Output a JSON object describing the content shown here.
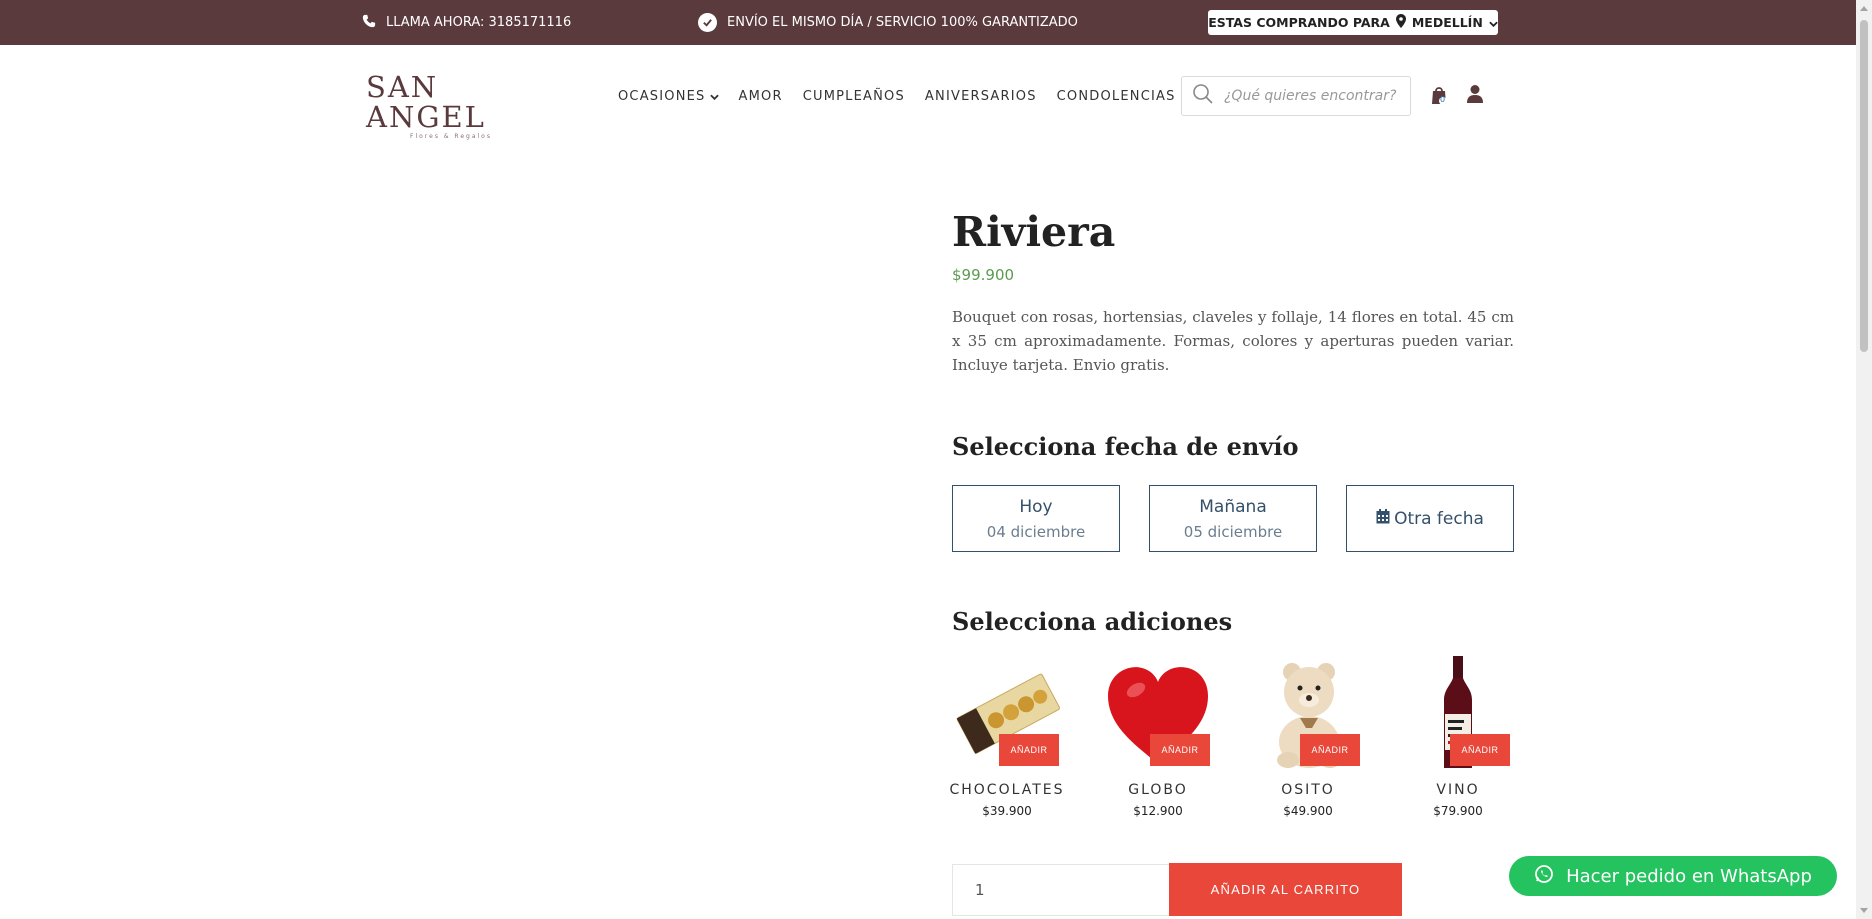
{
  "topbar": {
    "phone_label": "LLAMA AHORA: 3185171116",
    "shipping_label": "ENVÍO EL MISMO DÍA / SERVICIO 100% GARANTIZADO",
    "buying_for_label": "ESTAS COMPRANDO PARA",
    "city": "MEDELLÍN"
  },
  "logo": {
    "name": "SAN ANGEL",
    "tagline": "Flores & Regalos"
  },
  "nav": {
    "items": [
      {
        "label": "OCASIONES"
      },
      {
        "label": "AMOR"
      },
      {
        "label": "CUMPLEAÑOS"
      },
      {
        "label": "ANIVERSARIOS"
      },
      {
        "label": "CONDOLENCIAS"
      }
    ]
  },
  "search": {
    "placeholder": "¿Qué quieres encontrar?"
  },
  "cart": {
    "count": "0"
  },
  "product": {
    "title": "Riviera",
    "price": "$99.900",
    "description": "Bouquet con rosas, hortensias, claveles y follaje, 14 flores en total. 45  cm x 35 cm aproximadamente. Formas, colores y aperturas pueden variar. Incluye tarjeta. Envio gratis."
  },
  "delivery": {
    "heading": "Selecciona fecha de envío",
    "options": [
      {
        "label": "Hoy",
        "date": "04 diciembre"
      },
      {
        "label": "Mañana",
        "date": "05 diciembre"
      },
      {
        "label": "Otra fecha"
      }
    ]
  },
  "addons": {
    "heading": "Selecciona adiciones",
    "add_label": "AÑADIR",
    "items": [
      {
        "name": "CHOCOLATES",
        "price": "$39.900"
      },
      {
        "name": "GLOBO",
        "price": "$12.900"
      },
      {
        "name": "OSITO",
        "price": "$49.900"
      },
      {
        "name": "VINO",
        "price": "$79.900"
      }
    ]
  },
  "purchase": {
    "quantity": "1",
    "add_to_cart_label": "AÑADIR AL CARRITO"
  },
  "whatsapp": {
    "label": "Hacer pedido en WhatsApp"
  },
  "colors": {
    "topbar": "#5a3a3c",
    "accent": "#e8473a",
    "price": "#5b9b4f",
    "date_border": "#34506b",
    "whatsapp": "#25c260"
  }
}
